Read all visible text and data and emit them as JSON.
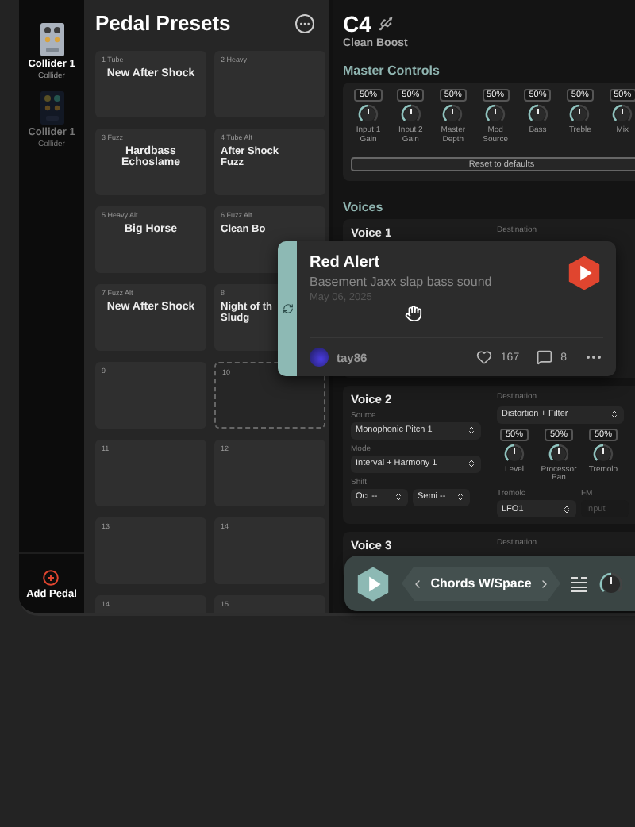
{
  "sidebar": {
    "pedals": [
      {
        "name": "Collider 1",
        "model": "Collider",
        "selected": true
      },
      {
        "name": "Collider 1",
        "model": "Collider",
        "selected": false
      }
    ],
    "add_button": "Add Pedal"
  },
  "presets": {
    "title": "Pedal Presets",
    "tiles": [
      {
        "slot": "1 Tube",
        "name": "New After Shock",
        "kind": "preset"
      },
      {
        "slot": "2 Heavy",
        "kind": "preset"
      },
      {
        "slot": "3 Fuzz",
        "name": "Hardbass Echoslame",
        "kind": "preset"
      },
      {
        "slot": "4 Tube Alt",
        "name": "After Shock Fuzz",
        "kind": "preset"
      },
      {
        "slot": "5 Heavy Alt",
        "name": "Big Horse",
        "kind": "preset"
      },
      {
        "slot": "6 Fuzz Alt",
        "name": "Clean Bo",
        "kind": "preset"
      },
      {
        "slot": "7 Fuzz Alt",
        "name": "New After Shock",
        "kind": "preset"
      },
      {
        "slot": "8",
        "name": "Night of th Sludg",
        "kind": "preset"
      },
      {
        "slot": "9",
        "kind": "preset"
      },
      {
        "slot": "10",
        "kind": "drop-target"
      },
      {
        "slot": "11",
        "kind": "preset"
      },
      {
        "slot": "12",
        "kind": "preset"
      },
      {
        "slot": "13",
        "kind": "preset"
      },
      {
        "slot": "14",
        "kind": "preset"
      },
      {
        "slot": "14",
        "kind": "preset"
      },
      {
        "slot": "15",
        "kind": "preset"
      }
    ]
  },
  "device": {
    "title": "C4",
    "preset": "Clean Boost"
  },
  "master_controls": {
    "title": "Master Controls",
    "knobs": [
      {
        "value": "50%",
        "label": "Input 1 Gain"
      },
      {
        "value": "50%",
        "label": "Input 2 Gain"
      },
      {
        "value": "50%",
        "label": "Master Depth"
      },
      {
        "value": "50%",
        "label": "Mod Source"
      },
      {
        "value": "50%",
        "label": "Bass"
      },
      {
        "value": "50%",
        "label": "Treble"
      },
      {
        "value": "50%",
        "label": "Mix"
      }
    ],
    "reset_button": "Reset to defaults"
  },
  "voices": {
    "title": "Voices",
    "items": [
      {
        "title": "Voice 1",
        "destination_label": "Destination"
      },
      {
        "title": "Voice 2",
        "destination_label": "Destination",
        "source_label": "Source",
        "source": "Monophonic Pitch 1",
        "mode_label": "Mode",
        "mode": "Interval + Harmony 1",
        "shift_label": "Shift",
        "shift_octave": "Oct --",
        "shift_semi": "Semi --",
        "destination": "Distortion + Filter",
        "knobs": [
          {
            "value": "50%",
            "label": "Level"
          },
          {
            "value": "50%",
            "label": "Processor Pan"
          },
          {
            "value": "50%",
            "label": "Tremolo"
          }
        ],
        "tremolo_label": "Tremolo",
        "tremolo": "LFO1",
        "fm_label": "FM",
        "fm": "Input",
        "fm_disabled": true
      },
      {
        "title": "Voice 3",
        "destination_label": "Destination"
      }
    ]
  },
  "notification": {
    "title": "Red Alert",
    "description": "Basement Jaxx slap bass sound",
    "date": "May 06, 2025",
    "user": "tay86",
    "likes": "167",
    "comments": "8"
  },
  "player": {
    "preset": "Chords W/Space"
  }
}
